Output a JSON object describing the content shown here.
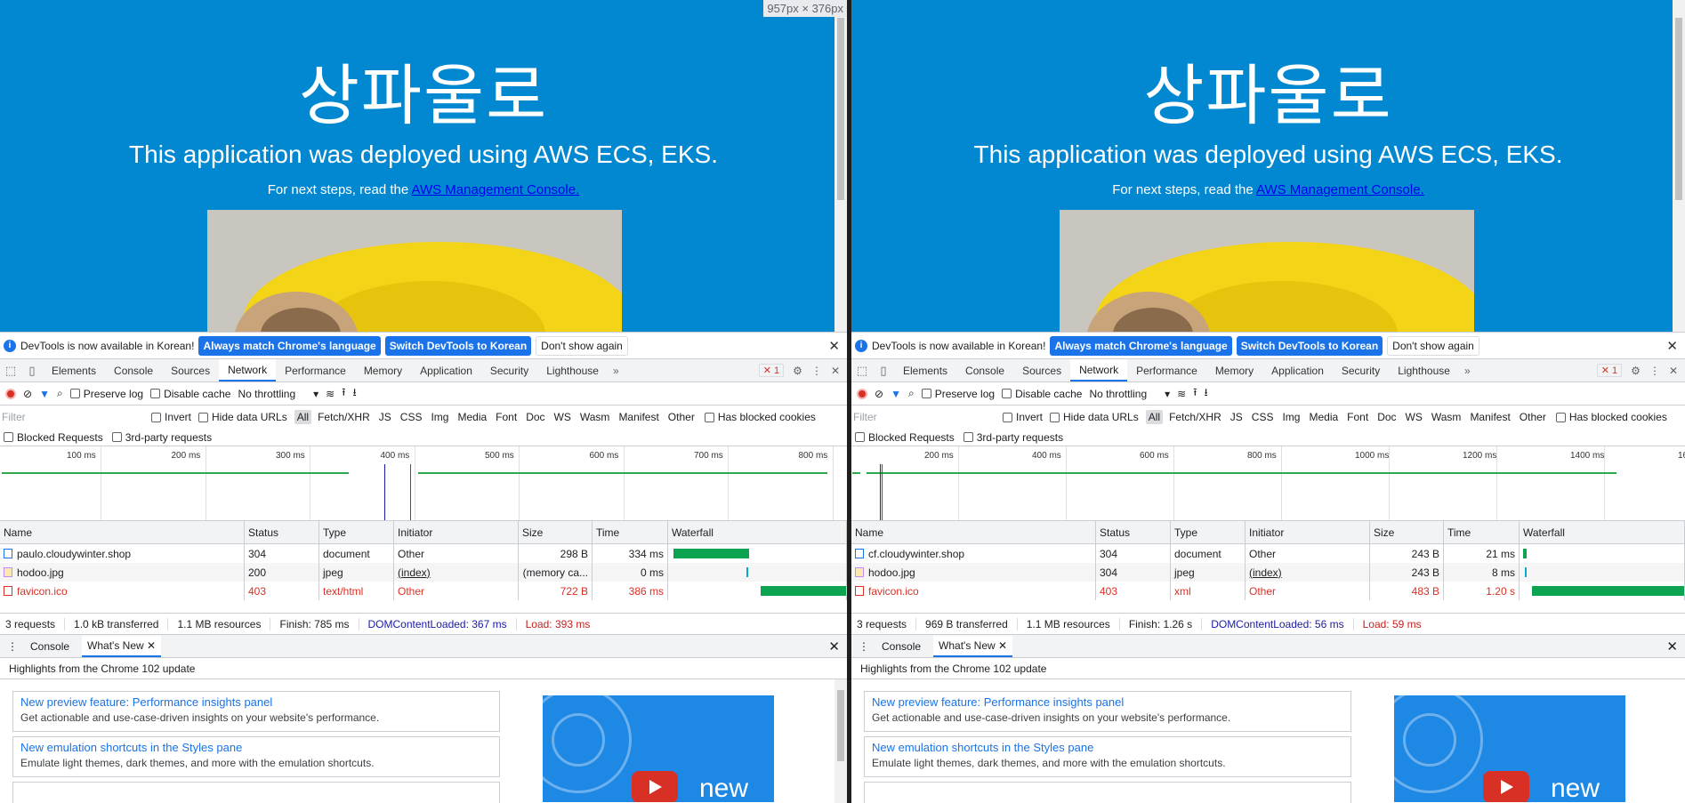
{
  "viewport_badge": "957px × 376px",
  "panes": [
    {
      "page": {
        "title": "상파울로",
        "subtitle": "This application was deployed using AWS ECS, EKS.",
        "next_steps_prefix": "For next steps, read the ",
        "next_steps_link": "AWS Management Console."
      },
      "infobar": {
        "message": "DevTools is now available in Korean!",
        "btn_match": "Always match Chrome's language",
        "btn_switch": "Switch DevTools to Korean",
        "btn_dont": "Don't show again"
      },
      "tabs": [
        "Elements",
        "Console",
        "Sources",
        "Network",
        "Performance",
        "Memory",
        "Application",
        "Security",
        "Lighthouse"
      ],
      "error_count": "1",
      "toolbar": {
        "preserve_log": "Preserve log",
        "disable_cache": "Disable cache",
        "throttling": "No throttling"
      },
      "filter": {
        "placeholder": "Filter",
        "invert": "Invert",
        "hide_data_urls": "Hide data URLs",
        "types": [
          "All",
          "Fetch/XHR",
          "JS",
          "CSS",
          "Img",
          "Media",
          "Font",
          "Doc",
          "WS",
          "Wasm",
          "Manifest",
          "Other"
        ],
        "has_blocked": "Has blocked cookies",
        "blocked_requests": "Blocked Requests",
        "third_party": "3rd-party requests"
      },
      "timeline_ticks": [
        "100 ms",
        "200 ms",
        "300 ms",
        "400 ms",
        "500 ms",
        "600 ms",
        "700 ms",
        "800 ms"
      ],
      "columns": [
        "Name",
        "Status",
        "Type",
        "Initiator",
        "Size",
        "Time",
        "Waterfall"
      ],
      "rows": [
        {
          "name": "paulo.cloudywinter.shop",
          "status": "304",
          "type": "document",
          "initiator": "Other",
          "size": "298 B",
          "time": "334 ms",
          "kind": "doc"
        },
        {
          "name": "hodoo.jpg",
          "status": "200",
          "type": "jpeg",
          "initiator": "(index)",
          "size": "(memory ca...",
          "time": "0 ms",
          "kind": "img"
        },
        {
          "name": "favicon.ico",
          "status": "403",
          "type": "text/html",
          "initiator": "Other",
          "size": "722 B",
          "time": "386 ms",
          "kind": "err"
        }
      ],
      "summary": {
        "requests": "3 requests",
        "transferred": "1.0 kB transferred",
        "resources": "1.1 MB resources",
        "finish": "Finish: 785 ms",
        "dcl": "DOMContentLoaded: 367 ms",
        "load": "Load: 393 ms"
      },
      "drawer": {
        "tabs": [
          "Console",
          "What's New"
        ],
        "highlights": "Highlights from the Chrome 102 update",
        "cards": [
          {
            "title": "New preview feature: Performance insights panel",
            "desc": "Get actionable and use-case-driven insights on your website's performance."
          },
          {
            "title": "New emulation shortcuts in the Styles pane",
            "desc": "Emulate light themes, dark themes, and more with the emulation shortcuts."
          }
        ],
        "promo_text": "new"
      }
    },
    {
      "page": {
        "title": "상파울로",
        "subtitle": "This application was deployed using AWS ECS, EKS.",
        "next_steps_prefix": "For next steps, read the ",
        "next_steps_link": "AWS Management Console."
      },
      "infobar": {
        "message": "DevTools is now available in Korean!",
        "btn_match": "Always match Chrome's language",
        "btn_switch": "Switch DevTools to Korean",
        "btn_dont": "Don't show again"
      },
      "tabs": [
        "Elements",
        "Console",
        "Sources",
        "Network",
        "Performance",
        "Memory",
        "Application",
        "Security",
        "Lighthouse"
      ],
      "error_count": "1",
      "toolbar": {
        "preserve_log": "Preserve log",
        "disable_cache": "Disable cache",
        "throttling": "No throttling"
      },
      "filter": {
        "placeholder": "Filter",
        "invert": "Invert",
        "hide_data_urls": "Hide data URLs",
        "types": [
          "All",
          "Fetch/XHR",
          "JS",
          "CSS",
          "Img",
          "Media",
          "Font",
          "Doc",
          "WS",
          "Wasm",
          "Manifest",
          "Other"
        ],
        "has_blocked": "Has blocked cookies",
        "blocked_requests": "Blocked Requests",
        "third_party": "3rd-party requests"
      },
      "timeline_ticks": [
        "200 ms",
        "400 ms",
        "600 ms",
        "800 ms",
        "1000 ms",
        "1200 ms",
        "1400 ms",
        "16"
      ],
      "columns": [
        "Name",
        "Status",
        "Type",
        "Initiator",
        "Size",
        "Time",
        "Waterfall"
      ],
      "rows": [
        {
          "name": "cf.cloudywinter.shop",
          "status": "304",
          "type": "document",
          "initiator": "Other",
          "size": "243 B",
          "time": "21 ms",
          "kind": "doc"
        },
        {
          "name": "hodoo.jpg",
          "status": "304",
          "type": "jpeg",
          "initiator": "(index)",
          "size": "243 B",
          "time": "8 ms",
          "kind": "img"
        },
        {
          "name": "favicon.ico",
          "status": "403",
          "type": "xml",
          "initiator": "Other",
          "size": "483 B",
          "time": "1.20 s",
          "kind": "err"
        }
      ],
      "summary": {
        "requests": "3 requests",
        "transferred": "969 B transferred",
        "resources": "1.1 MB resources",
        "finish": "Finish: 1.26 s",
        "dcl": "DOMContentLoaded: 56 ms",
        "load": "Load: 59 ms"
      },
      "drawer": {
        "tabs": [
          "Console",
          "What's New"
        ],
        "highlights": "Highlights from the Chrome 102 update",
        "cards": [
          {
            "title": "New preview feature: Performance insights panel",
            "desc": "Get actionable and use-case-driven insights on your website's performance."
          },
          {
            "title": "New emulation shortcuts in the Styles pane",
            "desc": "Emulate light themes, dark themes, and more with the emulation shortcuts."
          }
        ],
        "promo_text": "new"
      }
    }
  ],
  "colors": {
    "page_bg": "#0288d1",
    "accent": "#1a73e8",
    "error": "#d93025",
    "waterfall": "#0ca451"
  }
}
